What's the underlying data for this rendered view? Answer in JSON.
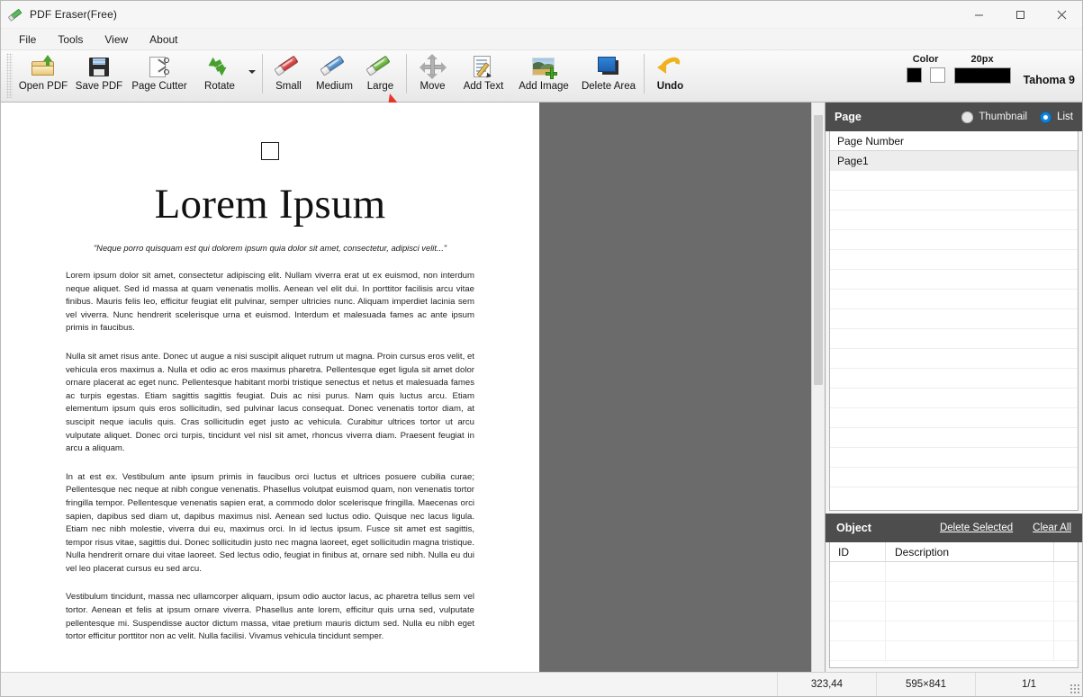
{
  "window": {
    "title": "PDF Eraser(Free)",
    "app_icon": "eraser-icon",
    "minimize_label": "Minimize",
    "maximize_label": "Maximize",
    "close_label": "Close"
  },
  "menubar": {
    "items": [
      {
        "label": "File"
      },
      {
        "label": "Tools"
      },
      {
        "label": "View"
      },
      {
        "label": "About"
      }
    ]
  },
  "toolbar": {
    "buttons": [
      {
        "label": "Open PDF",
        "icon": "open-folder-icon"
      },
      {
        "label": "Save PDF",
        "icon": "floppy-disk-icon"
      },
      {
        "label": "Page Cutter",
        "icon": "scissors-page-icon"
      },
      {
        "label": "Rotate",
        "icon": "rotate-arrows-icon"
      },
      {
        "label": "Small",
        "icon": "eraser-red-icon"
      },
      {
        "label": "Medium",
        "icon": "eraser-blue-icon"
      },
      {
        "label": "Large",
        "icon": "eraser-green-icon"
      },
      {
        "label": "Move",
        "icon": "four-way-arrow-icon"
      },
      {
        "label": "Add Text",
        "icon": "text-pencil-icon"
      },
      {
        "label": "Add Image",
        "icon": "picture-plus-icon"
      },
      {
        "label": "Delete Area",
        "icon": "blue-rectangles-icon"
      },
      {
        "label": "Undo",
        "icon": "undo-arrow-icon"
      }
    ],
    "color": {
      "label": "Color",
      "primary": "#000000",
      "secondary": "#ffffff"
    },
    "size": {
      "label": "20px",
      "bar_color": "#000000"
    },
    "font": {
      "label": "Tahoma 9"
    },
    "highlight_color": "#e8352b"
  },
  "document": {
    "square_mark": "",
    "title": "Lorem Ipsum",
    "quote": "\"Neque porro quisquam est qui dolorem ipsum quia dolor sit amet, consectetur, adipisci velit...\"",
    "paragraphs": [
      "Lorem ipsum dolor sit amet, consectetur adipiscing elit. Nullam viverra erat ut ex euismod, non interdum neque aliquet. Sed id massa at quam venenatis mollis. Aenean vel elit dui. In porttitor facilisis arcu vitae finibus. Mauris felis leo, efficitur feugiat elit pulvinar, semper ultricies nunc. Aliquam imperdiet lacinia sem vel viverra. Nunc hendrerit scelerisque urna et euismod. Interdum et malesuada fames ac ante ipsum primis in faucibus.",
      "Nulla sit amet risus ante. Donec ut augue a nisi suscipit aliquet rutrum ut magna. Proin cursus eros velit, et vehicula eros maximus a. Nulla et odio ac eros maximus pharetra. Pellentesque eget ligula sit amet dolor ornare placerat ac eget nunc. Pellentesque habitant morbi tristique senectus et netus et malesuada fames ac turpis egestas. Etiam sagittis sagittis feugiat. Duis ac nisi purus. Nam quis luctus arcu. Etiam elementum ipsum quis eros sollicitudin, sed pulvinar lacus consequat. Donec venenatis tortor diam, at suscipit neque iaculis quis. Cras sollicitudin eget justo ac vehicula. Curabitur ultrices tortor ut arcu vulputate aliquet. Donec orci turpis, tincidunt vel nisl sit amet, rhoncus viverra diam. Praesent feugiat in arcu a aliquam.",
      "In at est ex. Vestibulum ante ipsum primis in faucibus orci luctus et ultrices posuere cubilia curae; Pellentesque nec neque at nibh congue venenatis. Phasellus volutpat euismod quam, non venenatis tortor fringilla tempor. Pellentesque venenatis sapien erat, a commodo dolor scelerisque fringilla. Maecenas orci sapien, dapibus sed diam ut, dapibus maximus nisl. Aenean sed luctus odio. Quisque nec lacus ligula. Etiam nec nibh molestie, viverra dui eu, maximus orci. In id lectus ipsum. Fusce sit amet est sagittis, tempor risus vitae, sagittis dui. Donec sollicitudin justo nec magna laoreet, eget sollicitudin magna tristique. Nulla hendrerit ornare dui vitae laoreet. Sed lectus odio, feugiat in finibus at, ornare sed nibh. Nulla eu dui vel leo placerat cursus eu sed arcu.",
      "Vestibulum tincidunt, massa nec ullamcorper aliquam, ipsum odio auctor lacus, ac pharetra tellus sem vel tortor. Aenean et felis at ipsum ornare viverra. Phasellus ante lorem, efficitur quis urna sed, vulputate pellentesque mi. Suspendisse auctor dictum massa, vitae pretium mauris dictum sed. Nulla eu nibh eget tortor efficitur porttitor non ac velit. Nulla facilisi. Vivamus vehicula tincidunt semper."
    ]
  },
  "page_panel": {
    "title": "Page",
    "view_modes": [
      {
        "label": "Thumbnail",
        "selected": false
      },
      {
        "label": "List",
        "selected": true
      }
    ],
    "column_header": "Page Number",
    "rows": [
      {
        "label": "Page1",
        "selected": true
      }
    ],
    "empty_row_count": 17
  },
  "object_panel": {
    "title": "Object",
    "actions": [
      {
        "label": "Delete Selected"
      },
      {
        "label": "Clear All"
      }
    ],
    "columns": [
      {
        "label": "ID"
      },
      {
        "label": "Description"
      }
    ],
    "rows": [],
    "empty_row_count": 5
  },
  "statusbar": {
    "cursor_position": "323,44",
    "page_size": "595×841",
    "page_counter": "1/1"
  }
}
